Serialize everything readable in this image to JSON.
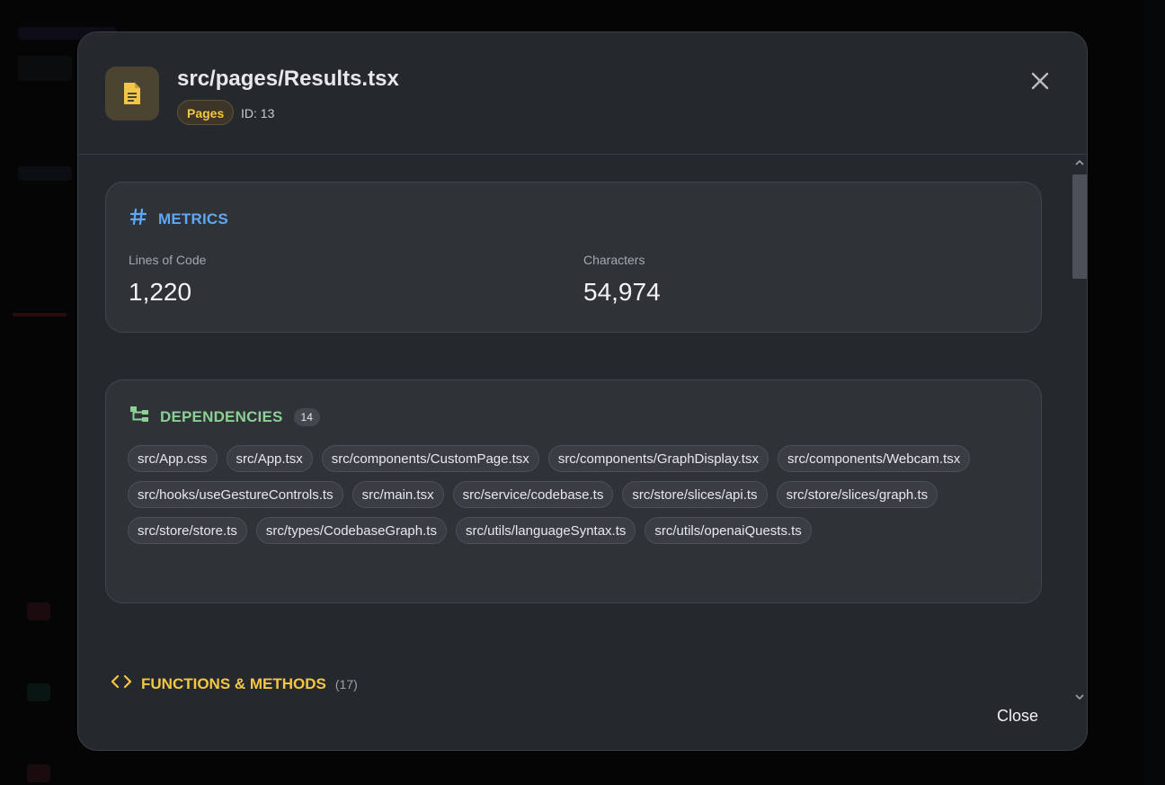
{
  "modal": {
    "title": "src/pages/Results.tsx",
    "category_badge": "Pages",
    "id_label": "ID: 13",
    "close_label": "Close"
  },
  "metrics": {
    "heading": "METRICS",
    "lines_label": "Lines of Code",
    "lines_value": "1,220",
    "chars_label": "Characters",
    "chars_value": "54,974"
  },
  "dependencies": {
    "heading": "DEPENDENCIES",
    "count": "14",
    "items": [
      "src/App.css",
      "src/App.tsx",
      "src/components/CustomPage.tsx",
      "src/components/GraphDisplay.tsx",
      "src/components/Webcam.tsx",
      "src/hooks/useGestureControls.ts",
      "src/main.tsx",
      "src/service/codebase.ts",
      "src/store/slices/api.ts",
      "src/store/slices/graph.ts",
      "src/store/store.ts",
      "src/types/CodebaseGraph.ts",
      "src/utils/languageSyntax.ts",
      "src/utils/openaiQuests.ts"
    ]
  },
  "functions": {
    "heading": "FUNCTIONS & METHODS",
    "count": "(17)"
  },
  "colors": {
    "modal_bg": "#25282d",
    "metrics_accent": "#5fa8f5",
    "deps_accent": "#8dd095",
    "funcs_accent": "#f4c646",
    "badge_text": "#f4c646"
  },
  "icons": {
    "file": "document-icon",
    "close": "close-icon",
    "metrics": "hash-icon",
    "deps": "sitemap-icon",
    "funcs": "code-brackets-icon"
  }
}
